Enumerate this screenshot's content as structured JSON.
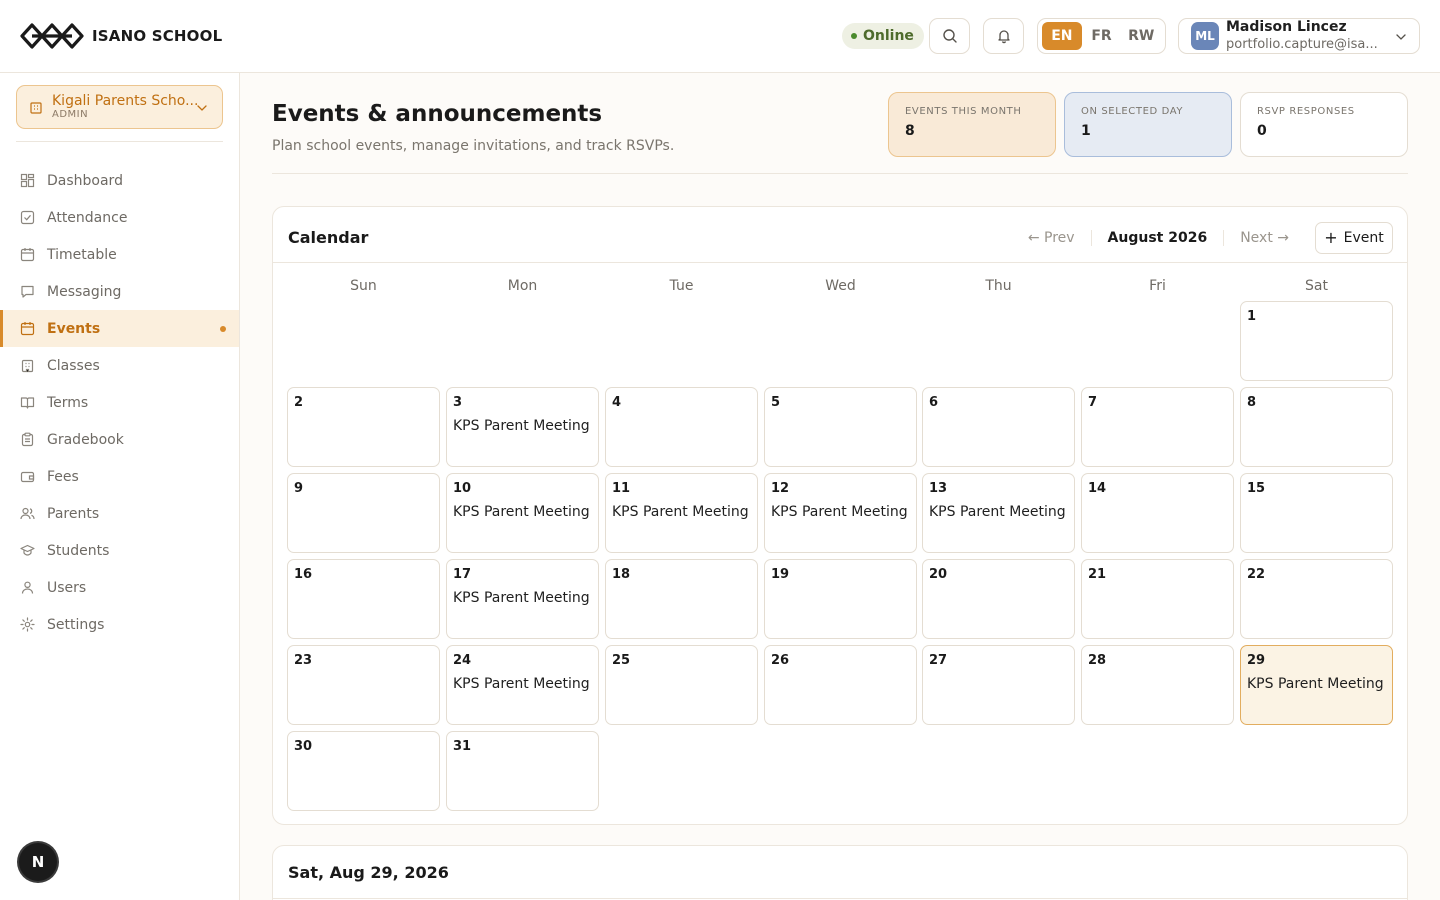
{
  "brand": {
    "name": "ISANO SCHOOL"
  },
  "header": {
    "status": "Online",
    "languages": [
      "EN",
      "FR",
      "RW"
    ],
    "active_language": "EN",
    "user": {
      "initials": "ML",
      "name": "Madison Lincez",
      "email": "portfolio.capture@isa..."
    }
  },
  "sidebar": {
    "school": {
      "name": "Kigali Parents Scho...",
      "role": "ADMIN"
    },
    "items": [
      {
        "label": "Dashboard",
        "icon": "dashboard-icon"
      },
      {
        "label": "Attendance",
        "icon": "check-square-icon"
      },
      {
        "label": "Timetable",
        "icon": "calendar-icon"
      },
      {
        "label": "Messaging",
        "icon": "chat-icon"
      },
      {
        "label": "Events",
        "icon": "calendar-icon",
        "active": true
      },
      {
        "label": "Classes",
        "icon": "building-icon"
      },
      {
        "label": "Terms",
        "icon": "book-icon"
      },
      {
        "label": "Gradebook",
        "icon": "clipboard-icon"
      },
      {
        "label": "Fees",
        "icon": "wallet-icon"
      },
      {
        "label": "Parents",
        "icon": "users-icon"
      },
      {
        "label": "Students",
        "icon": "graduation-cap-icon"
      },
      {
        "label": "Users",
        "icon": "user-icon"
      },
      {
        "label": "Settings",
        "icon": "gear-icon"
      }
    ],
    "floating_button": "N"
  },
  "main": {
    "title": "Events & announcements",
    "subtitle": "Plan school events, manage invitations, and track RSVPs.",
    "stats": [
      {
        "label": "EVENTS THIS MONTH",
        "value": "8"
      },
      {
        "label": "ON SELECTED DAY",
        "value": "1"
      },
      {
        "label": "RSVP RESPONSES",
        "value": "0"
      }
    ],
    "calendar": {
      "title": "Calendar",
      "prev": "← Prev",
      "month": "August 2026",
      "next": "Next →",
      "add_label": "Event",
      "weekdays": [
        "Sun",
        "Mon",
        "Tue",
        "Wed",
        "Thu",
        "Fri",
        "Sat"
      ],
      "days": [
        {
          "num": "1",
          "event": ""
        },
        {
          "num": "2",
          "event": ""
        },
        {
          "num": "3",
          "event": "KPS Parent Meeting"
        },
        {
          "num": "4",
          "event": ""
        },
        {
          "num": "5",
          "event": ""
        },
        {
          "num": "6",
          "event": ""
        },
        {
          "num": "7",
          "event": ""
        },
        {
          "num": "8",
          "event": ""
        },
        {
          "num": "9",
          "event": ""
        },
        {
          "num": "10",
          "event": "KPS Parent Meeting"
        },
        {
          "num": "11",
          "event": "KPS Parent Meeting"
        },
        {
          "num": "12",
          "event": "KPS Parent Meeting"
        },
        {
          "num": "13",
          "event": "KPS Parent Meeting"
        },
        {
          "num": "14",
          "event": ""
        },
        {
          "num": "15",
          "event": ""
        },
        {
          "num": "16",
          "event": ""
        },
        {
          "num": "17",
          "event": "KPS Parent Meeting"
        },
        {
          "num": "18",
          "event": ""
        },
        {
          "num": "19",
          "event": ""
        },
        {
          "num": "20",
          "event": ""
        },
        {
          "num": "21",
          "event": ""
        },
        {
          "num": "22",
          "event": ""
        },
        {
          "num": "23",
          "event": ""
        },
        {
          "num": "24",
          "event": "KPS Parent Meeting"
        },
        {
          "num": "25",
          "event": ""
        },
        {
          "num": "26",
          "event": ""
        },
        {
          "num": "27",
          "event": ""
        },
        {
          "num": "28",
          "event": ""
        },
        {
          "num": "29",
          "event": "KPS Parent Meeting",
          "selected": true
        },
        {
          "num": "30",
          "event": ""
        },
        {
          "num": "31",
          "event": ""
        }
      ]
    },
    "selected_day_title": "Sat, Aug 29, 2026"
  },
  "colors": {
    "accent": "#d88a2a",
    "selected_day_bg": "#fbf3e4",
    "online": "#4a8a2c"
  }
}
